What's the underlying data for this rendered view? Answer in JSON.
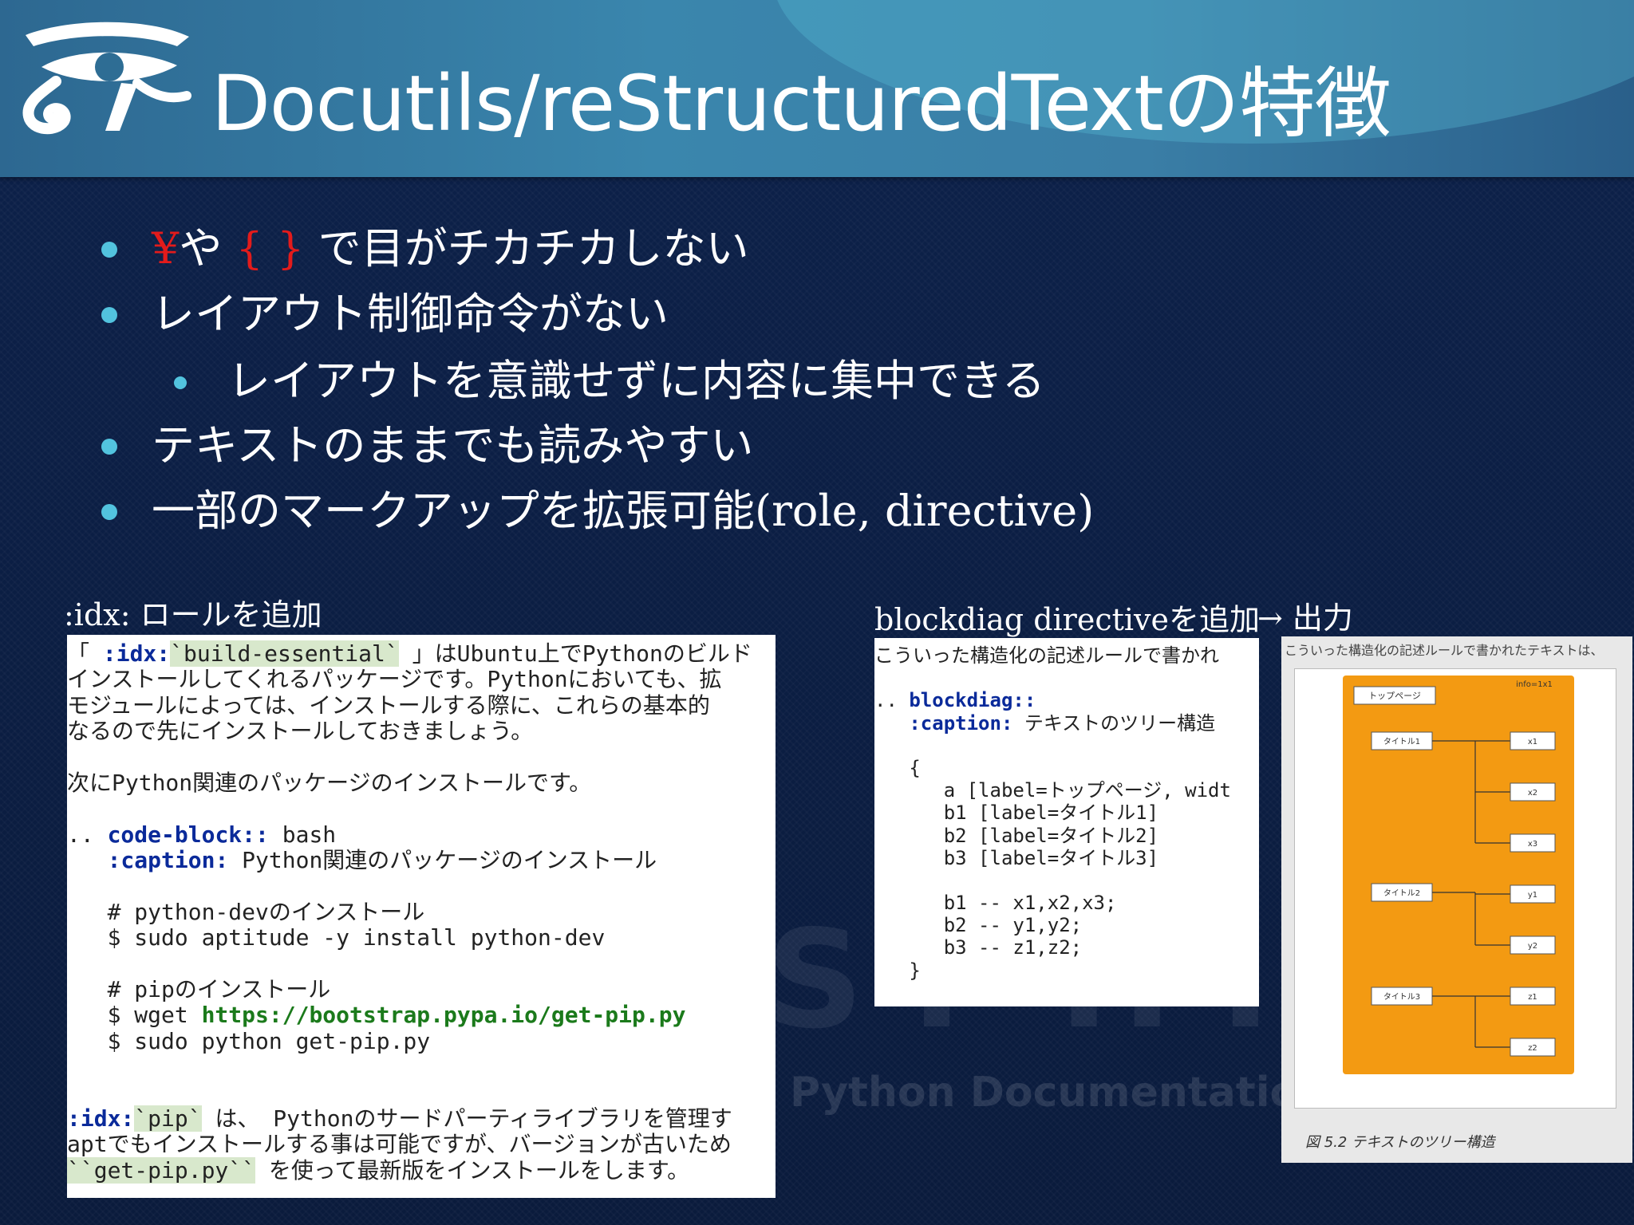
{
  "slide": {
    "title": "Docutils/reStructuredTextの特徴",
    "logo_icon": "eye-of-horus-icon"
  },
  "bullets": [
    {
      "parts": [
        "¥",
        "や ",
        "{ }",
        " で目がチカチカしない"
      ],
      "level": 1
    },
    {
      "text": "レイアウト制御命令がない",
      "level": 1
    },
    {
      "text": "レイアウトを意識せずに内容に集中できる",
      "level": 2
    },
    {
      "text": "テキストのままでも読みやすい",
      "level": 1
    },
    {
      "text": "一部のマークアップを拡張可能(role, directive)",
      "level": 1
    }
  ],
  "left_example": {
    "label": ":idx: ロールを追加",
    "lines": [
      [
        {
          "t": "「 "
        },
        {
          "t": ":idx:",
          "c": "kw"
        },
        {
          "t": "`build-essential`",
          "c": "hl"
        },
        {
          "t": " 」はUbuntu上でPythonのビルド"
        }
      ],
      [
        {
          "t": "インストールしてくれるパッケージです。Pythonにおいても、拡"
        }
      ],
      [
        {
          "t": "モジュールによっては、インストールする際に、これらの基本的"
        }
      ],
      [
        {
          "t": "なるので先にインストールしておきましょう。"
        }
      ],
      [
        {
          "t": ""
        }
      ],
      [
        {
          "t": "次にPython関連のパッケージのインストールです。"
        }
      ],
      [
        {
          "t": ""
        }
      ],
      [
        {
          "t": ".. "
        },
        {
          "t": "code-block::",
          "c": "kw"
        },
        {
          "t": " bash"
        }
      ],
      [
        {
          "t": "   "
        },
        {
          "t": ":caption:",
          "c": "kw"
        },
        {
          "t": " Python関連のパッケージのインストール"
        }
      ],
      [
        {
          "t": ""
        }
      ],
      [
        {
          "t": "   # python-devのインストール"
        }
      ],
      [
        {
          "t": "   $ sudo aptitude -y install python-dev"
        }
      ],
      [
        {
          "t": ""
        }
      ],
      [
        {
          "t": "   # pipのインストール"
        }
      ],
      [
        {
          "t": "   $ wget "
        },
        {
          "t": "https://bootstrap.pypa.io/get-pip.py",
          "c": "url"
        }
      ],
      [
        {
          "t": "   $ sudo python get-pip.py"
        }
      ],
      [
        {
          "t": ""
        }
      ],
      [
        {
          "t": ""
        }
      ],
      [
        {
          "t": ":idx:",
          "c": "kw"
        },
        {
          "t": "`pip`",
          "c": "hl"
        },
        {
          "t": " は、 Pythonのサードパーティライブラリを管理す"
        }
      ],
      [
        {
          "t": "aptでもインストールする事は可能ですが、バージョンが古いため"
        }
      ],
      [
        {
          "t": "``get-pip.py``",
          "c": "hl"
        },
        {
          "t": " を使って最新版をインストールをします。"
        }
      ]
    ]
  },
  "right_example": {
    "label": "blockdiag directiveを追加",
    "arrow_label": "→ 出力",
    "lines": [
      [
        {
          "t": "こういった構造化の記述ルールで書かれ"
        }
      ],
      [
        {
          "t": ""
        }
      ],
      [
        {
          "t": ".. "
        },
        {
          "t": "blockdiag::",
          "c": "kw"
        }
      ],
      [
        {
          "t": "   "
        },
        {
          "t": ":caption:",
          "c": "kw"
        },
        {
          "t": " テキストのツリー構造"
        }
      ],
      [
        {
          "t": ""
        }
      ],
      [
        {
          "t": "   {"
        }
      ],
      [
        {
          "t": "      a [label=トップページ, widt"
        }
      ],
      [
        {
          "t": "      b1 [label=タイトル1]"
        }
      ],
      [
        {
          "t": "      b2 [label=タイトル2]"
        }
      ],
      [
        {
          "t": "      b3 [label=タイトル3]"
        }
      ],
      [
        {
          "t": ""
        }
      ],
      [
        {
          "t": "      b1 -- x1,x2,x3;"
        }
      ],
      [
        {
          "t": "      b2 -- y1,y2;"
        }
      ],
      [
        {
          "t": "      b3 -- z1,z2;"
        }
      ],
      [
        {
          "t": "   }"
        }
      ]
    ]
  },
  "diagram_output": {
    "top_text": "こういった構造化の記述ルールで書かれたテキストは、",
    "root": "トップページ",
    "root_note": "info=1x1",
    "groups": [
      {
        "label": "タイトル1",
        "children": [
          "x1",
          "x2",
          "x3"
        ]
      },
      {
        "label": "タイトル2",
        "children": [
          "y1",
          "y2"
        ]
      },
      {
        "label": "タイトル3",
        "children": [
          "z1",
          "z2"
        ]
      }
    ],
    "caption": "図 5.2 テキストのツリー構造",
    "colors": {
      "group_fill": "#f39a12",
      "node_fill": "#ffffff",
      "edge": "#333333"
    }
  },
  "watermark": {
    "big": "SPHINX",
    "small": "Python Documentation"
  }
}
